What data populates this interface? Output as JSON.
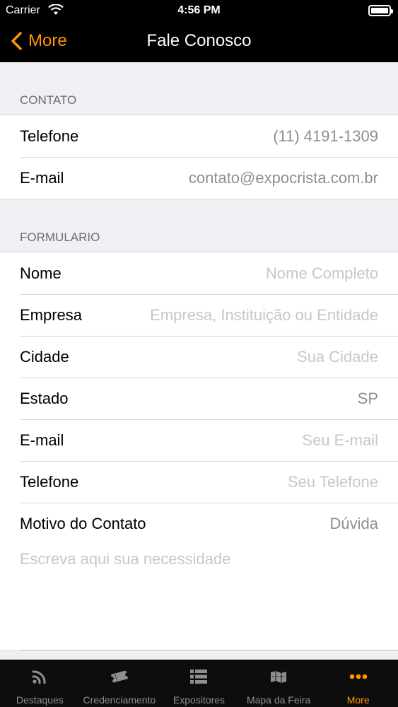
{
  "status_bar": {
    "carrier": "Carrier",
    "time": "4:56 PM"
  },
  "nav": {
    "back_label": "More",
    "title": "Fale Conosco"
  },
  "contact": {
    "header": "CONTATO",
    "rows": [
      {
        "label": "Telefone",
        "value": "(11) 4191-1309"
      },
      {
        "label": "E-mail",
        "value": "contato@expocrista.com.br"
      }
    ]
  },
  "form": {
    "header": "FORMULARIO",
    "fields": [
      {
        "label": "Nome",
        "placeholder": "Nome Completo"
      },
      {
        "label": "Empresa",
        "placeholder": "Empresa, Instituição ou Entidade"
      },
      {
        "label": "Cidade",
        "placeholder": "Sua Cidade"
      },
      {
        "label": "Estado",
        "value": "SP"
      },
      {
        "label": "E-mail",
        "placeholder": "Seu E-mail"
      },
      {
        "label": "Telefone",
        "placeholder": "Seu Telefone"
      },
      {
        "label": "Motivo do Contato",
        "value": "Dúvida"
      }
    ],
    "message_placeholder": "Escreva aqui sua necessidade"
  },
  "tabs": [
    {
      "label": "Destaques",
      "icon": "rss-icon",
      "active": false
    },
    {
      "label": "Credenciamento",
      "icon": "ticket-icon",
      "active": false
    },
    {
      "label": "Expositores",
      "icon": "list-icon",
      "active": false
    },
    {
      "label": "Mapa da Feira",
      "icon": "map-icon",
      "active": false
    },
    {
      "label": "More",
      "icon": "more-icon",
      "active": true
    }
  ],
  "colors": {
    "accent": "#ff9500",
    "inactive_tab": "#8e8e93",
    "placeholder": "#c7c7cc"
  }
}
